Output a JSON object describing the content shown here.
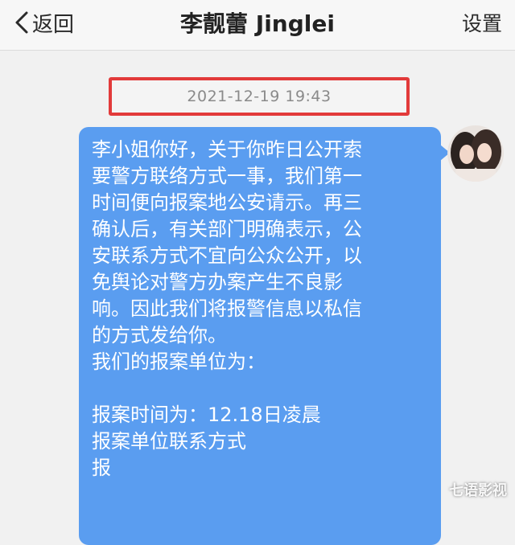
{
  "nav": {
    "back_label": "返回",
    "title": "李靓蕾 Jinglei",
    "settings_label": "设置"
  },
  "chat": {
    "timestamp": "2021-12-19 19:43",
    "message_lines": [
      "李小姐你好，关于你昨日公开索",
      "要警方联络方式一事，我们第一",
      "时间便向报案地公安请示。再三",
      "确认后，有关部门明确表示，公",
      "安联系方式不宜向公众公开，以",
      "免舆论对警方办案产生不良影",
      "响。因此我们将报警信息以私信",
      "的方式发给你。",
      "我们的报案单位为：",
      "",
      "报案时间为：12.18日凌晨",
      "报案单位联系方式",
      "报"
    ],
    "bubble_color": "#5a9df0",
    "highlight_color": "#e23a3a"
  },
  "watermark": "七语影视",
  "icons": {
    "back": "chevron-left-icon",
    "avatar": "user-avatar"
  }
}
